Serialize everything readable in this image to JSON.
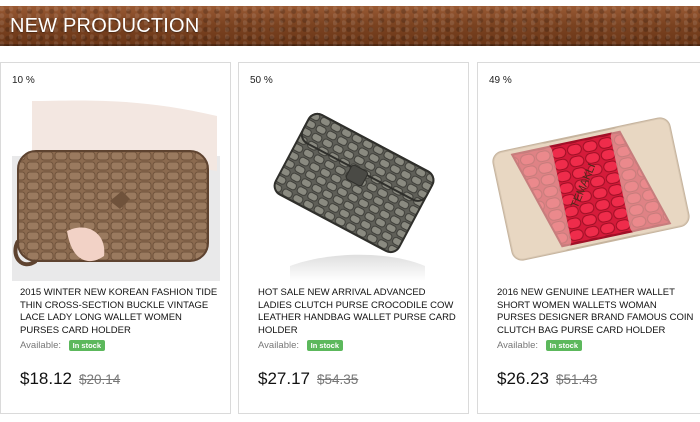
{
  "banner": {
    "title": "NEW PRODUCTION"
  },
  "products": [
    {
      "discount": "10 %",
      "title": "2015 WINTER NEW KOREAN FASHION TIDE THIN CROSS-SECTION BUCKLE VINTAGE LACE LADY LONG WALLET WOMEN PURSES CARD HOLDER",
      "availability_label": "Available:",
      "stock_badge": "In stock",
      "price": "$18.12",
      "old_price": "$20.14",
      "image": "brown-croc-wallet-in-hand"
    },
    {
      "discount": "50 %",
      "title": "HOT SALE NEW ARRIVAL ADVANCED LADIES CLUTCH PURSE CROCODILE COW LEATHER HANDBAG WALLET PURSE CARD HOLDER",
      "availability_label": "Available:",
      "stock_badge": "In stock",
      "price": "$27.17",
      "old_price": "$54.35",
      "image": "metallic-croc-wallet"
    },
    {
      "discount": "49 %",
      "title": "2016 NEW GENUINE LEATHER WALLET SHORT WOMEN WALLETS WOMAN PURSES DESIGNER BRAND FAMOUS COIN CLUTCH BAG PURSE CARD HOLDER",
      "availability_label": "Available:",
      "stock_badge": "In stock",
      "price": "$26.23",
      "old_price": "$51.43",
      "image": "red-beige-wallet",
      "brand_text": "TEMAKLI"
    }
  ]
}
